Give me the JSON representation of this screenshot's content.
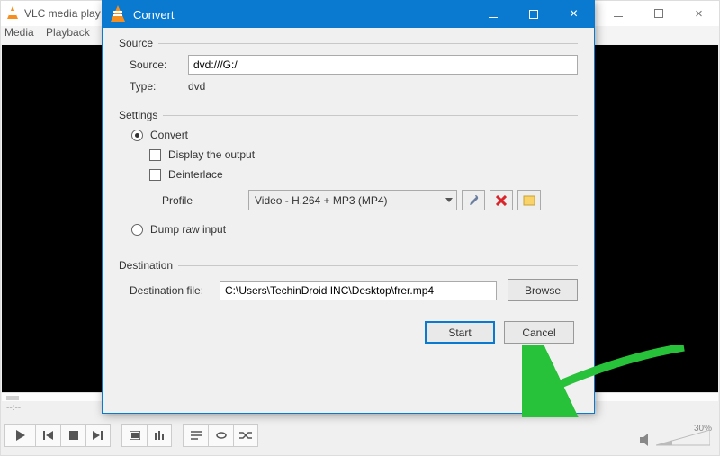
{
  "vlc": {
    "title": "VLC media play",
    "menu": {
      "media": "Media",
      "playback": "Playback"
    },
    "time": "--:--",
    "volume_pct": "30%"
  },
  "dialog": {
    "title": "Convert",
    "source_legend": "Source",
    "source_label": "Source:",
    "source_value": "dvd:///G:/",
    "type_label": "Type:",
    "type_value": "dvd",
    "settings_legend": "Settings",
    "convert_label": "Convert",
    "display_output_label": "Display the output",
    "deinterlace_label": "Deinterlace",
    "profile_label": "Profile",
    "profile_value": "Video - H.264 + MP3 (MP4)",
    "dump_label": "Dump raw input",
    "dest_legend": "Destination",
    "dest_file_label": "Destination file:",
    "dest_file_value": "C:\\Users\\TechinDroid INC\\Desktop\\frer.mp4",
    "browse_btn": "Browse",
    "start_btn": "Start",
    "cancel_btn": "Cancel"
  }
}
